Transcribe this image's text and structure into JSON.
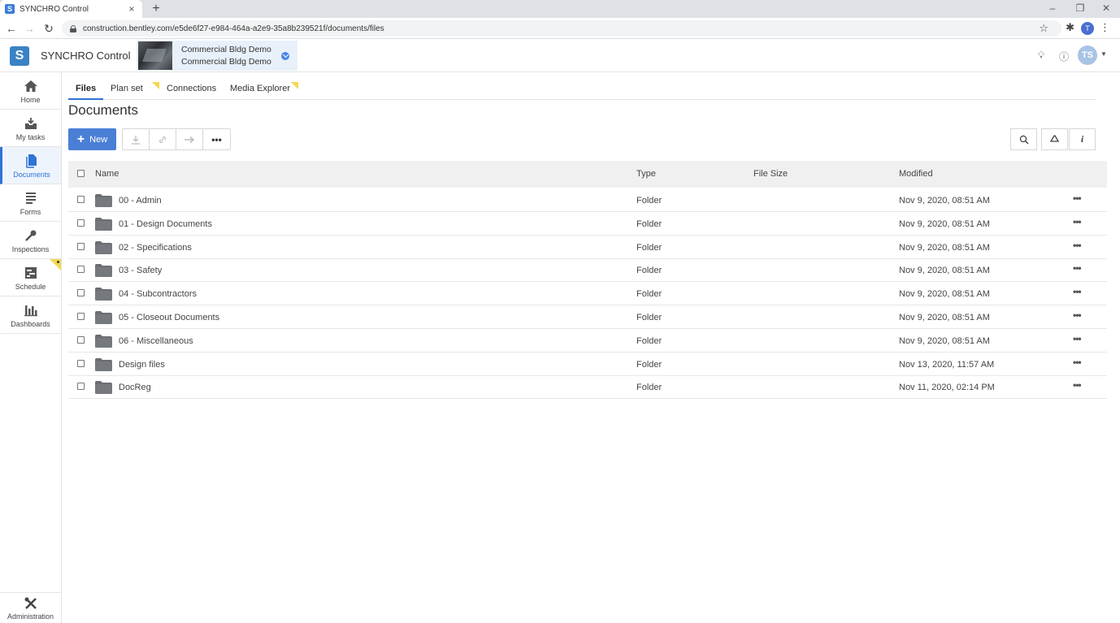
{
  "browser": {
    "tab_title": "SYNCHRO Control",
    "tab_close": "×",
    "new_tab": "+",
    "url": "construction.bentley.com/e5de6f27-e984-464a-a2e9-35a8b239521f/documents/files",
    "profile_initial": "T"
  },
  "app": {
    "name": "SYNCHRO Control",
    "project_line1": "Commercial Bldg Demo",
    "project_line2": "Commercial Bldg Demo",
    "user_initials": "TS"
  },
  "sidebar": {
    "items": [
      {
        "label": "Home",
        "icon": "home-icon"
      },
      {
        "label": "My tasks",
        "icon": "inbox-icon"
      },
      {
        "label": "Documents",
        "icon": "document-icon",
        "active": true
      },
      {
        "label": "Forms",
        "icon": "forms-icon"
      },
      {
        "label": "Inspections",
        "icon": "inspection-icon"
      },
      {
        "label": "Schedule",
        "icon": "schedule-icon"
      },
      {
        "label": "Dashboards",
        "icon": "dashboard-icon"
      }
    ],
    "admin_label": "Administration"
  },
  "tabs": [
    {
      "label": "Files",
      "active": true
    },
    {
      "label": "Plan set"
    },
    {
      "label": "Connections"
    },
    {
      "label": "Media Explorer"
    }
  ],
  "page_title": "Documents",
  "toolbar": {
    "new_label": "New",
    "more_label": "•••"
  },
  "table": {
    "columns": {
      "name": "Name",
      "type": "Type",
      "size": "File Size",
      "modified": "Modified"
    },
    "row_menu": "•••",
    "rows": [
      {
        "name": "00 - Admin",
        "type": "Folder",
        "size": "",
        "modified": "Nov 9, 2020, 08:51 AM"
      },
      {
        "name": "01 - Design Documents",
        "type": "Folder",
        "size": "",
        "modified": "Nov 9, 2020, 08:51 AM"
      },
      {
        "name": "02 - Specifications",
        "type": "Folder",
        "size": "",
        "modified": "Nov 9, 2020, 08:51 AM"
      },
      {
        "name": "03 - Safety",
        "type": "Folder",
        "size": "",
        "modified": "Nov 9, 2020, 08:51 AM"
      },
      {
        "name": "04 - Subcontractors",
        "type": "Folder",
        "size": "",
        "modified": "Nov 9, 2020, 08:51 AM"
      },
      {
        "name": "05 - Closeout Documents",
        "type": "Folder",
        "size": "",
        "modified": "Nov 9, 2020, 08:51 AM"
      },
      {
        "name": "06 - Miscellaneous",
        "type": "Folder",
        "size": "",
        "modified": "Nov 9, 2020, 08:51 AM"
      },
      {
        "name": "Design files",
        "type": "Folder",
        "size": "",
        "modified": "Nov 13, 2020, 11:57 AM"
      },
      {
        "name": "DocReg",
        "type": "Folder",
        "size": "",
        "modified": "Nov 11, 2020, 02:14 PM"
      }
    ]
  },
  "colors": {
    "accent": "#2f73d4",
    "new_button": "#4a7fd6",
    "flag": "#f2d94e"
  }
}
